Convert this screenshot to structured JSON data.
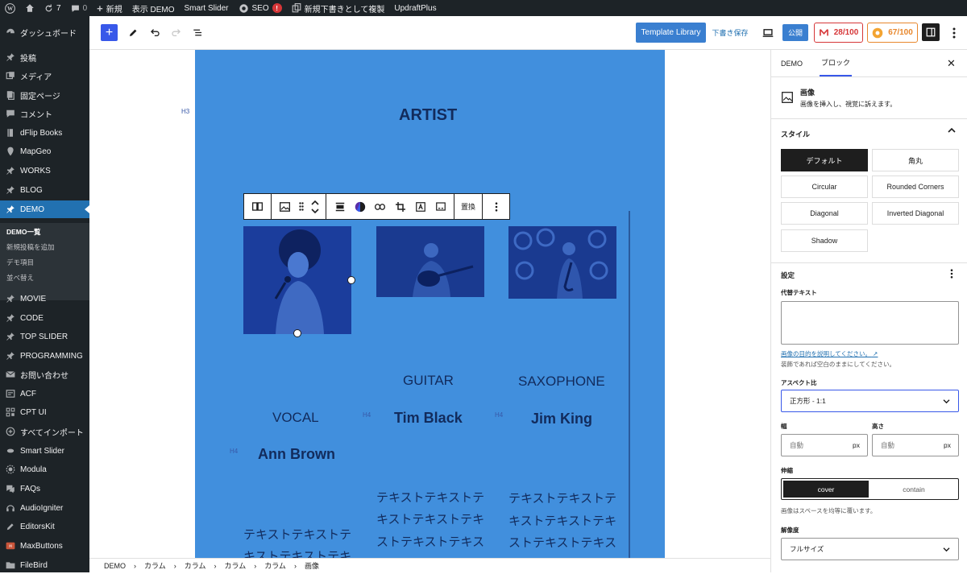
{
  "admin_bar": {
    "updates_count": "7",
    "comments_count": "0",
    "new_label": "新規",
    "view_label": "表示 DEMO",
    "smart_slider": "Smart Slider",
    "seo_label": "SEO",
    "seo_badge": "!",
    "duplicate_label": "新規下書きとして複製",
    "updraft": "UpdraftPlus"
  },
  "sidebar": {
    "items": [
      {
        "label": "ダッシュボード",
        "icon": "dashboard-icon"
      },
      {
        "label": "投稿",
        "icon": "pin-icon"
      },
      {
        "label": "メディア",
        "icon": "media-icon"
      },
      {
        "label": "固定ページ",
        "icon": "page-icon"
      },
      {
        "label": "コメント",
        "icon": "comment-icon"
      },
      {
        "label": "dFlip Books",
        "icon": "book-icon"
      },
      {
        "label": "MapGeo",
        "icon": "location-icon"
      },
      {
        "label": "WORKS",
        "icon": "pin-icon"
      },
      {
        "label": "BLOG",
        "icon": "pin-icon"
      },
      {
        "label": "DEMO",
        "icon": "pin-icon"
      },
      {
        "label": "MOVIE",
        "icon": "pin-icon"
      },
      {
        "label": "CODE",
        "icon": "pin-icon"
      },
      {
        "label": "TOP SLIDER",
        "icon": "pin-icon"
      },
      {
        "label": "PROGRAMMING",
        "icon": "pin-icon"
      },
      {
        "label": "お問い合わせ",
        "icon": "mail-icon"
      },
      {
        "label": "ACF",
        "icon": "acf-icon"
      },
      {
        "label": "CPT UI",
        "icon": "cpt-icon"
      },
      {
        "label": "すべてインポート",
        "icon": "import-icon"
      },
      {
        "label": "Smart Slider",
        "icon": "slider-icon"
      },
      {
        "label": "Modula",
        "icon": "modula-icon"
      },
      {
        "label": "FAQs",
        "icon": "faq-icon"
      },
      {
        "label": "AudioIgniter",
        "icon": "audio-icon"
      },
      {
        "label": "EditorsKit",
        "icon": "editorskit-icon"
      },
      {
        "label": "MaxButtons",
        "icon": "maxbuttons-icon"
      },
      {
        "label": "FileBird",
        "icon": "folder-icon"
      }
    ],
    "submenu": [
      "DEMO一覧",
      "新規投稿を追加",
      "デモ項目",
      "並べ替え"
    ]
  },
  "toolbar": {
    "template_library": "Template Library",
    "save_draft": "下書き保存",
    "publish": "公開",
    "score1": "28/100",
    "score2": "67/100"
  },
  "canvas": {
    "h3_label": "H3",
    "title": "ARTIST",
    "h4_label": "H4",
    "columns": [
      {
        "role": "VOCAL",
        "name": "Ann Brown",
        "text": [
          "テキストテキストテ",
          "キストテキストテキ"
        ]
      },
      {
        "role": "GUITAR",
        "name": "Tim Black",
        "text": [
          "テキストテキストテ",
          "キストテキストテキ",
          "ストテキストテキス"
        ]
      },
      {
        "role": "SAXOPHONE",
        "name": "Jim King",
        "text": [
          "テキストテキストテ",
          "キストテキストテキ",
          "ストテキストテキス"
        ]
      }
    ],
    "block_toolbar": {
      "replace": "置換"
    }
  },
  "panel": {
    "tab_demo": "DEMO",
    "tab_block": "ブロック",
    "block_name": "画像",
    "block_desc": "画像を挿入し、視覚に訴えます。",
    "style_heading": "スタイル",
    "styles": [
      "デフォルト",
      "角丸",
      "Circular",
      "Rounded Corners",
      "Diagonal",
      "Inverted Diagonal",
      "Shadow"
    ],
    "settings_heading": "設定",
    "alt_label": "代替テキスト",
    "alt_link": "画像の目的を説明してください。",
    "alt_help": "装飾であれば空白のままにしてください。",
    "aspect_label": "アスペクト比",
    "aspect_value": "正方形 - 1:1",
    "width_label": "幅",
    "height_label": "高さ",
    "auto_placeholder": "自動",
    "unit": "px",
    "scale_label": "伸縮",
    "cover": "cover",
    "contain": "contain",
    "scale_help": "画像はスペースを均等に覆います。",
    "resolution_label": "解像度",
    "resolution_value": "フルサイズ"
  },
  "breadcrumb": [
    "DEMO",
    "カラム",
    "カラム",
    "カラム",
    "カラム",
    "画像"
  ],
  "colors": {
    "admin_dark": "#1d2327",
    "wp_blue": "#2271b1",
    "canvas_blue": "#418fdd",
    "heading_navy": "#122b5c",
    "score_red": "#d63638",
    "score_orange": "#e8872c"
  }
}
